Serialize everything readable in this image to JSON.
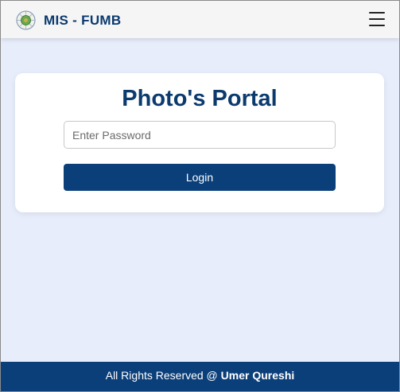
{
  "header": {
    "brand": "MIS - FUMB",
    "logo_icon": "university-seal-icon",
    "menu_icon": "hamburger-menu-icon"
  },
  "login_card": {
    "title": "Photo's Portal",
    "password_placeholder": "Enter Password",
    "password_value": "",
    "login_label": "Login"
  },
  "footer": {
    "text": "All Rights Reserved @ ",
    "author": "Umer Qureshi"
  },
  "colors": {
    "brand": "#0b3a6e",
    "primary": "#0b3f7a",
    "background": "#e7edfb"
  }
}
